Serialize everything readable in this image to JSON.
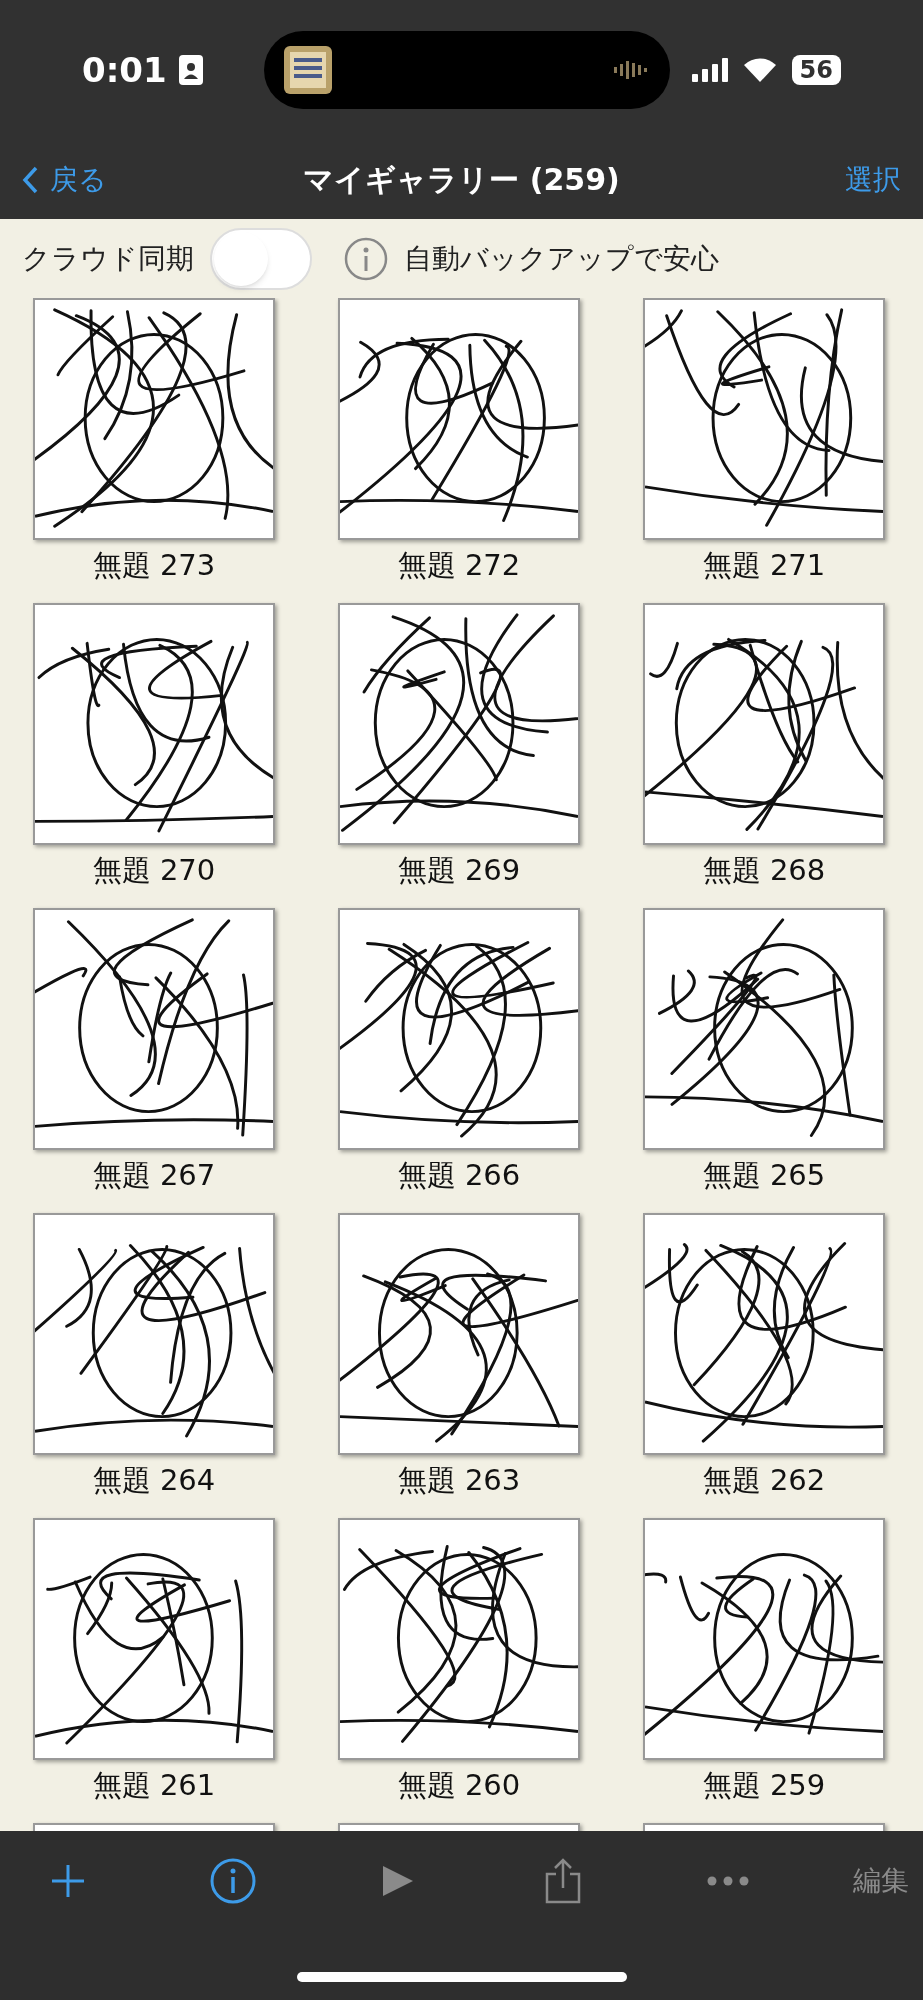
{
  "status_bar": {
    "time": "0:01",
    "battery": "56"
  },
  "nav": {
    "back": "戻る",
    "title": "マイギャラリー (259)",
    "action": "選択"
  },
  "sync": {
    "label": "クラウド同期",
    "on": false,
    "note": "自動バックアップで安心"
  },
  "gallery": [
    {
      "kind": "picture",
      "title": "無題 273"
    },
    {
      "kind": "picture",
      "title": "無題 272"
    },
    {
      "kind": "picture",
      "title": "無題 271"
    },
    {
      "kind": "picture",
      "title": "無題 270"
    },
    {
      "kind": "picture",
      "title": "無題 269"
    },
    {
      "kind": "picture",
      "title": "無題 268"
    },
    {
      "kind": "picture",
      "title": "無題 267"
    },
    {
      "kind": "picture",
      "title": "無題 266"
    },
    {
      "kind": "picture",
      "title": "無題 265"
    },
    {
      "kind": "picture",
      "title": "無題 264"
    },
    {
      "kind": "picture",
      "title": "無題 263"
    },
    {
      "kind": "picture",
      "title": "無題 262"
    },
    {
      "kind": "picture",
      "title": "無題 261"
    },
    {
      "kind": "picture",
      "title": "無題 260"
    },
    {
      "kind": "picture",
      "title": "無題 259"
    },
    {
      "kind": "picture"
    },
    {
      "kind": "picture"
    },
    {
      "kind": "picture"
    }
  ],
  "toolbar": [
    {
      "kind": "add",
      "disabled": false
    },
    {
      "kind": "info",
      "disabled": false
    },
    {
      "kind": "play",
      "disabled": true
    },
    {
      "kind": "share",
      "disabled": true
    },
    {
      "kind": "more",
      "disabled": true
    },
    {
      "kind": "text",
      "label": "編集",
      "disabled": true
    }
  ]
}
